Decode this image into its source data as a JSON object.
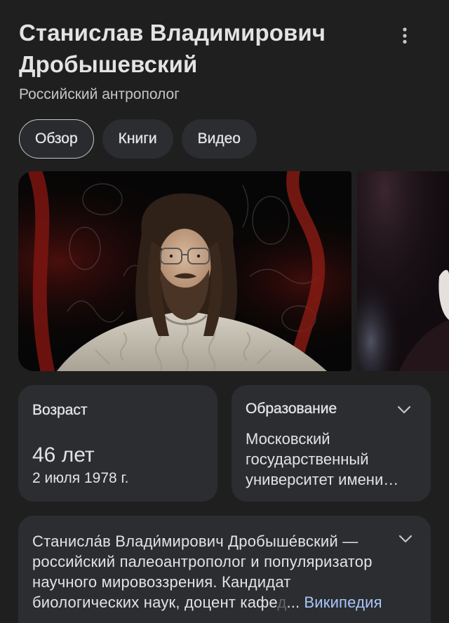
{
  "header": {
    "title": "Станислав Владимирович Дробышевский",
    "subtitle": "Российский антрополог",
    "menu_icon": "more-vert-icon"
  },
  "tabs": [
    {
      "label": "Обзор",
      "selected": true
    },
    {
      "label": "Книги",
      "selected": false
    },
    {
      "label": "Видео",
      "selected": false
    }
  ],
  "facts": {
    "age": {
      "label": "Возраст",
      "value": "46 лет",
      "birth_date": "2 июля 1978 г."
    },
    "education": {
      "label": "Образование",
      "value_lines": [
        "Московский",
        "государственный",
        "университет имени…"
      ],
      "expand_icon": "chevron-down-icon"
    }
  },
  "description": {
    "lines": [
      "Станисла́в Влади́мирович Дробыше́вский —",
      "российский палеоантрополог и популяризатор",
      "научного мировоззрения. Кандидат",
      "биологических наук, доцент кафе"
    ],
    "faded_text": "д",
    "ellipsis": "...",
    "source_link": "Википедия",
    "expand_icon": "chevron-down-icon"
  },
  "colors": {
    "background": "#1f1f1f",
    "card": "#2c2d31",
    "text": "#e3e3e3",
    "subtext": "#c4c7c5",
    "link": "#a8c7fa",
    "chip_selected_border": "#c4c7c5"
  }
}
